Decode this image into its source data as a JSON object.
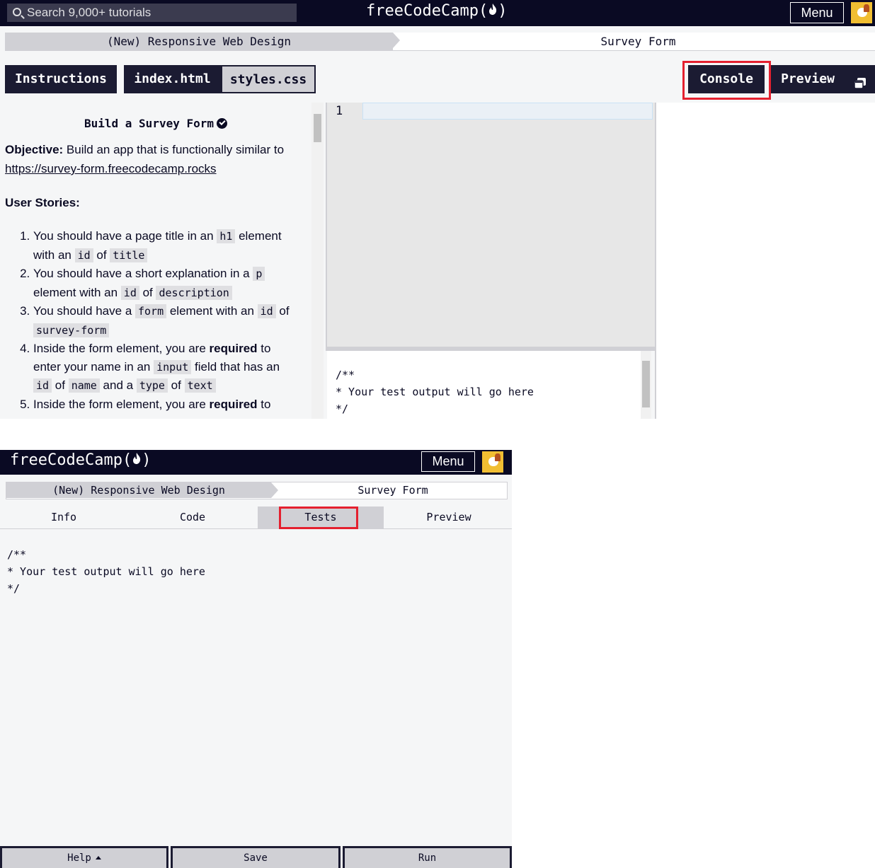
{
  "desktop": {
    "nav": {
      "search_placeholder": "Search 9,000+ tutorials",
      "logo_text": "freeCodeCamp(",
      "logo_close": ")",
      "menu_label": "Menu"
    },
    "breadcrumb": {
      "course": "(New) Responsive Web Design",
      "project": "Survey Form"
    },
    "tabs": {
      "instructions": "Instructions",
      "index_html": "index.html",
      "styles_css": "styles.css",
      "console": "Console",
      "preview": "Preview"
    },
    "instructions": {
      "title": "Build a Survey Form",
      "objective_label": "Objective:",
      "objective_text": " Build an app that is functionally similar to ",
      "objective_link": "https://survey-form.freecodecamp.rocks",
      "user_stories_heading": "User Stories:",
      "stories": [
        {
          "t1": "You should have a page title in an ",
          "c1": "h1",
          "t2": " element with an ",
          "c2": "id",
          "t3": " of ",
          "c3": "title"
        },
        {
          "t1": "You should have a short explanation in a ",
          "c1": "p",
          "t2": " element with an ",
          "c2": "id",
          "t3": " of ",
          "c3": "description"
        },
        {
          "t1": "You should have a ",
          "c1": "form",
          "t2": " element with an ",
          "c2": "id",
          "t3": " of ",
          "c3": "survey-form"
        },
        {
          "t1": "Inside the form element, you are ",
          "b1": "required",
          "t2": " to enter your name in an ",
          "c1": "input",
          "t3": " field that has an ",
          "c2": "id",
          "t4": " of ",
          "c3": "name",
          "t5": " and a ",
          "c4": "type",
          "t6": " of ",
          "c5": "text"
        },
        {
          "t1": "Inside the form element, you are ",
          "b1": "required",
          "t2": " to"
        }
      ]
    },
    "editor": {
      "line_number": "1"
    },
    "console_output": "/**\n* Your test output will go here\n*/"
  },
  "mobile": {
    "nav": {
      "logo_text": "freeCodeCamp(",
      "logo_close": ")",
      "menu_label": "Menu"
    },
    "breadcrumb": {
      "course": "(New) Responsive Web Design",
      "project": "Survey Form"
    },
    "tabs": {
      "info": "Info",
      "code": "Code",
      "tests": "Tests",
      "preview": "Preview"
    },
    "console_output": "/**\n* Your test output will go here\n*/",
    "bottom_bar": {
      "help": "Help",
      "save": "Save",
      "run": "Run"
    }
  },
  "colors": {
    "nav_bg": "#0a0a23",
    "highlight": "#e4202f",
    "tab_dark": "#1b1b32",
    "tab_light": "#d0d0d5"
  }
}
